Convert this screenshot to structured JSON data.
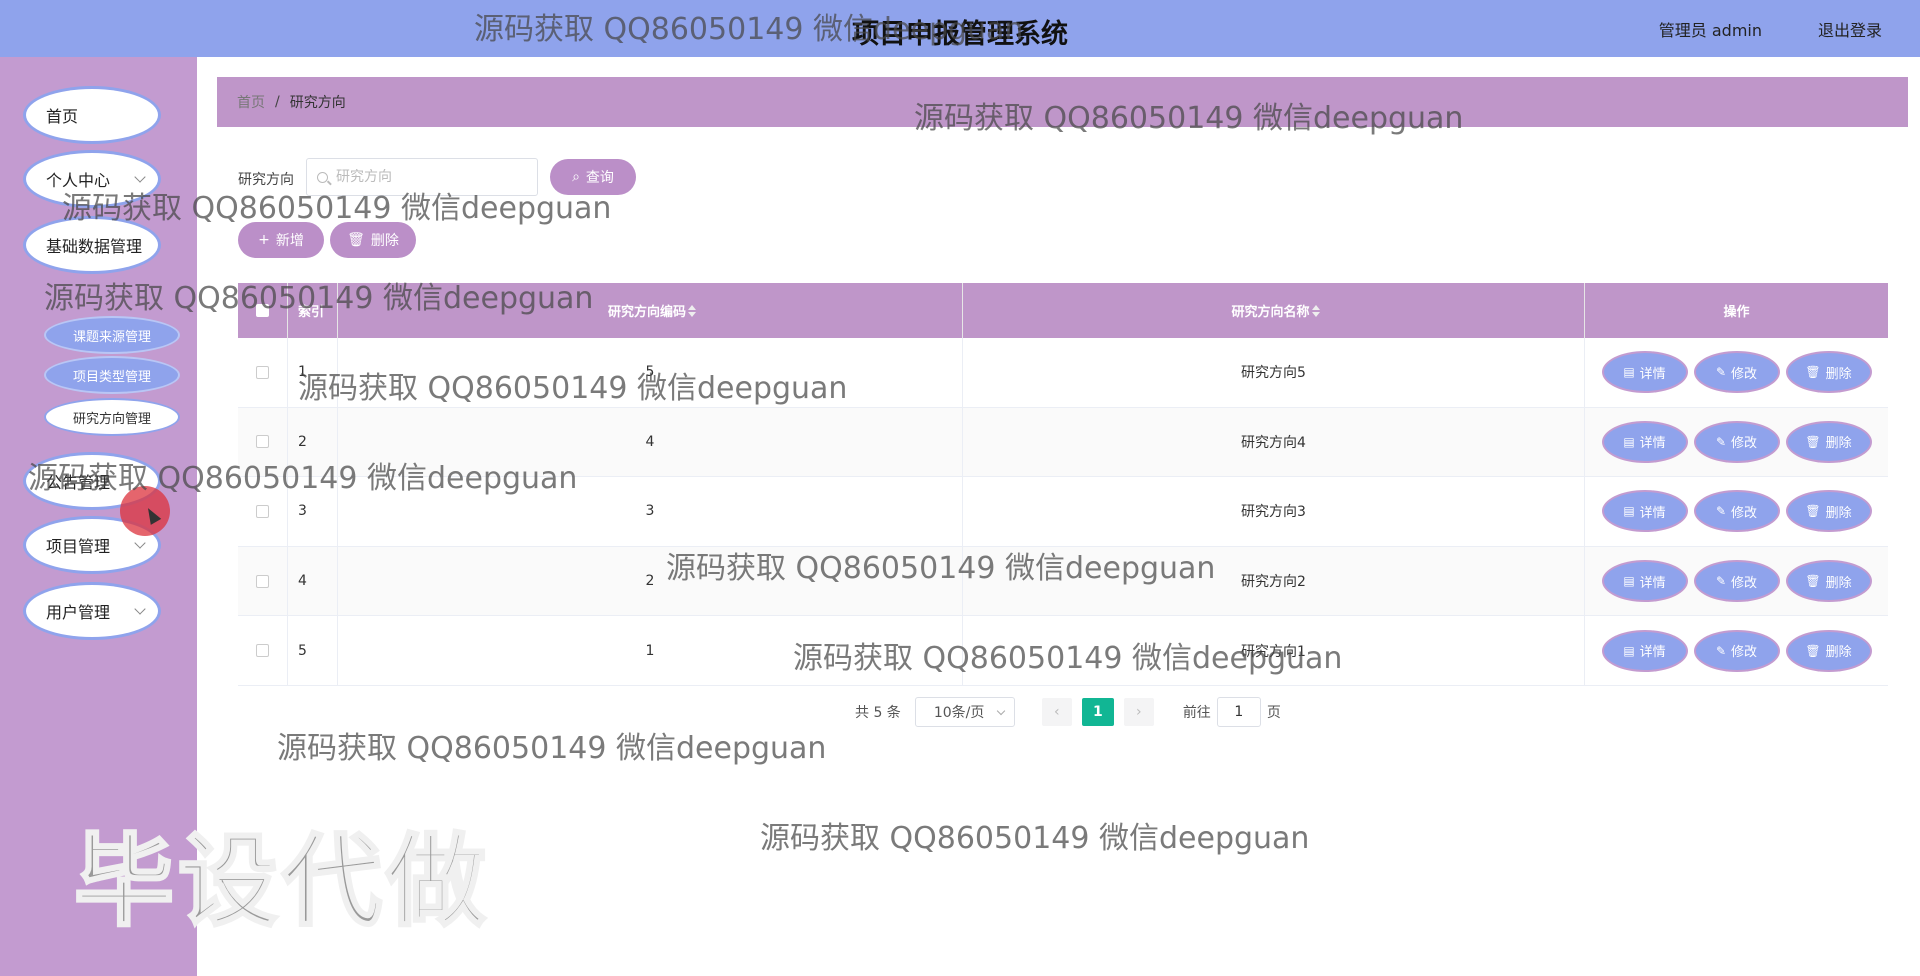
{
  "header": {
    "title": "项目申报管理系统",
    "user": "管理员 admin",
    "logout": "退出登录"
  },
  "sidebar": {
    "items": [
      {
        "label": "首页"
      },
      {
        "label": "个人中心"
      },
      {
        "label": "基础数据管理"
      },
      {
        "label": "公告管理"
      },
      {
        "label": "项目管理"
      },
      {
        "label": "用户管理"
      }
    ],
    "sub_items": [
      {
        "label": "课题来源管理"
      },
      {
        "label": "项目类型管理"
      },
      {
        "label": "研究方向管理"
      }
    ]
  },
  "breadcrumb": {
    "home": "首页",
    "sep": "/",
    "current": "研究方向"
  },
  "search": {
    "label": "研究方向",
    "placeholder": "研究方向",
    "query_label": "查询"
  },
  "actions": {
    "add_label": "新增",
    "delete_label": "删除"
  },
  "table": {
    "headers": {
      "index": "索引",
      "code": "研究方向编码",
      "name": "研究方向名称",
      "op": "操作"
    },
    "rows": [
      {
        "index": "1",
        "code": "5",
        "name": "研究方向5"
      },
      {
        "index": "2",
        "code": "4",
        "name": "研究方向4"
      },
      {
        "index": "3",
        "code": "3",
        "name": "研究方向3"
      },
      {
        "index": "4",
        "code": "2",
        "name": "研究方向2"
      },
      {
        "index": "5",
        "code": "1",
        "name": "研究方向1"
      }
    ],
    "op_labels": {
      "detail": "详情",
      "edit": "修改",
      "delete": "删除"
    }
  },
  "pagination": {
    "total": "共 5 条",
    "page_size": "10条/页",
    "current_page": "1",
    "goto_prefix": "前往",
    "goto_value": "1",
    "goto_suffix": "页"
  },
  "watermark": {
    "text": "源码获取 QQ86050149 微信deepguan",
    "big": "毕设代做"
  }
}
